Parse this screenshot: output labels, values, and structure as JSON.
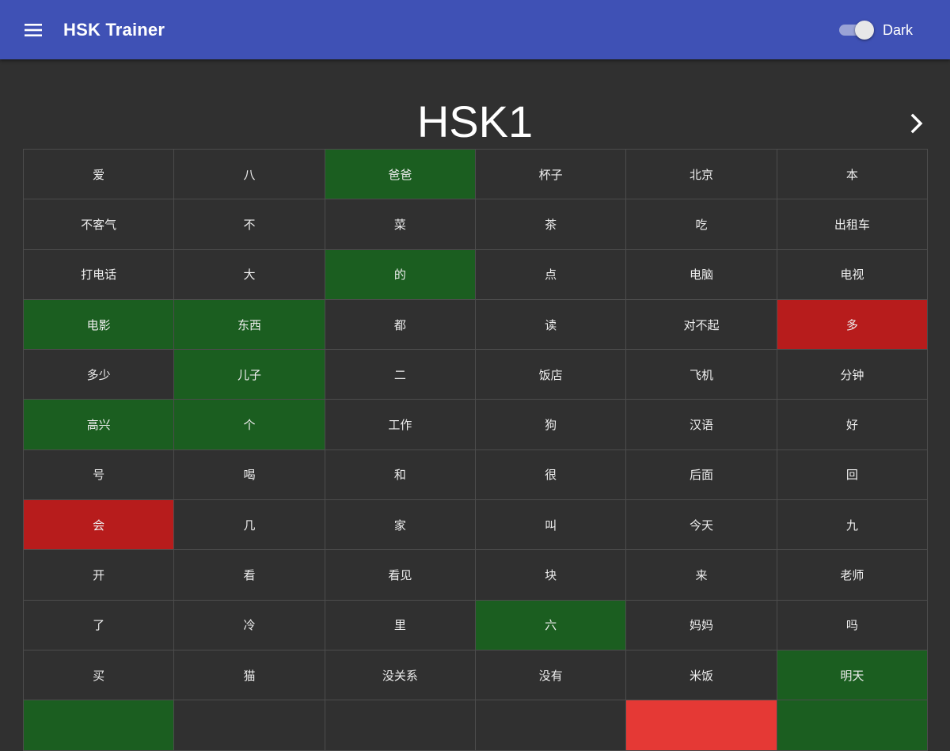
{
  "app_bar": {
    "title": "HSK Trainer",
    "menu_icon": "hamburger-menu-icon",
    "theme_toggle": {
      "label": "Dark",
      "on": true
    },
    "color": "#3f51b5"
  },
  "level": {
    "title": "HSK1",
    "next_icon": "chevron-right-icon"
  },
  "status_colors": {
    "default": "#303030",
    "correct": "#1b5e20",
    "wrong": "#b71c1c",
    "wrong_light": "#e53935"
  },
  "words": [
    {
      "text": "爱",
      "status": "default"
    },
    {
      "text": "八",
      "status": "default"
    },
    {
      "text": "爸爸",
      "status": "correct"
    },
    {
      "text": "杯子",
      "status": "default"
    },
    {
      "text": "北京",
      "status": "default"
    },
    {
      "text": "本",
      "status": "default"
    },
    {
      "text": "不客气",
      "status": "default"
    },
    {
      "text": "不",
      "status": "default"
    },
    {
      "text": "菜",
      "status": "default"
    },
    {
      "text": "茶",
      "status": "default"
    },
    {
      "text": "吃",
      "status": "default"
    },
    {
      "text": "出租车",
      "status": "default"
    },
    {
      "text": "打电话",
      "status": "default"
    },
    {
      "text": "大",
      "status": "default"
    },
    {
      "text": "的",
      "status": "correct"
    },
    {
      "text": "点",
      "status": "default"
    },
    {
      "text": "电脑",
      "status": "default"
    },
    {
      "text": "电视",
      "status": "default"
    },
    {
      "text": "电影",
      "status": "correct"
    },
    {
      "text": "东西",
      "status": "correct"
    },
    {
      "text": "都",
      "status": "default"
    },
    {
      "text": "读",
      "status": "default"
    },
    {
      "text": "对不起",
      "status": "default"
    },
    {
      "text": "多",
      "status": "wrong"
    },
    {
      "text": "多少",
      "status": "default"
    },
    {
      "text": "儿子",
      "status": "correct"
    },
    {
      "text": "二",
      "status": "default"
    },
    {
      "text": "饭店",
      "status": "default"
    },
    {
      "text": "飞机",
      "status": "default"
    },
    {
      "text": "分钟",
      "status": "default"
    },
    {
      "text": "高兴",
      "status": "correct"
    },
    {
      "text": "个",
      "status": "correct"
    },
    {
      "text": "工作",
      "status": "default"
    },
    {
      "text": "狗",
      "status": "default"
    },
    {
      "text": "汉语",
      "status": "default"
    },
    {
      "text": "好",
      "status": "default"
    },
    {
      "text": "号",
      "status": "default"
    },
    {
      "text": "喝",
      "status": "default"
    },
    {
      "text": "和",
      "status": "default"
    },
    {
      "text": "很",
      "status": "default"
    },
    {
      "text": "后面",
      "status": "default"
    },
    {
      "text": "回",
      "status": "default"
    },
    {
      "text": "会",
      "status": "wrong"
    },
    {
      "text": "几",
      "status": "default"
    },
    {
      "text": "家",
      "status": "default"
    },
    {
      "text": "叫",
      "status": "default"
    },
    {
      "text": "今天",
      "status": "default"
    },
    {
      "text": "九",
      "status": "default"
    },
    {
      "text": "开",
      "status": "default"
    },
    {
      "text": "看",
      "status": "default"
    },
    {
      "text": "看见",
      "status": "default"
    },
    {
      "text": "块",
      "status": "default"
    },
    {
      "text": "来",
      "status": "default"
    },
    {
      "text": "老师",
      "status": "default"
    },
    {
      "text": "了",
      "status": "default"
    },
    {
      "text": "冷",
      "status": "default"
    },
    {
      "text": "里",
      "status": "default"
    },
    {
      "text": "六",
      "status": "correct"
    },
    {
      "text": "妈妈",
      "status": "default"
    },
    {
      "text": "吗",
      "status": "default"
    },
    {
      "text": "买",
      "status": "default"
    },
    {
      "text": "猫",
      "status": "default"
    },
    {
      "text": "没关系",
      "status": "default"
    },
    {
      "text": "没有",
      "status": "default"
    },
    {
      "text": "米饭",
      "status": "default"
    },
    {
      "text": "明天",
      "status": "correct"
    },
    {
      "text": "",
      "status": "correct"
    },
    {
      "text": "",
      "status": "default"
    },
    {
      "text": "",
      "status": "default"
    },
    {
      "text": "",
      "status": "default"
    },
    {
      "text": "",
      "status": "wrong_light"
    },
    {
      "text": "",
      "status": "correct"
    }
  ]
}
